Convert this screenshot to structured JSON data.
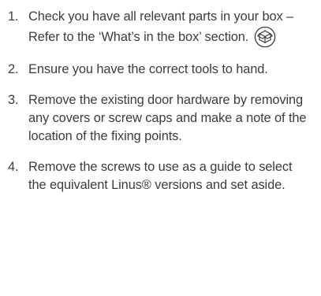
{
  "steps": [
    {
      "number": "1.",
      "text": "Check you have all relevant parts in your box – Refer to the ‘What’s in the box’ section.",
      "icon": "box-parts-icon"
    },
    {
      "number": "2.",
      "text": "Ensure you have the correct tools to hand."
    },
    {
      "number": "3.",
      "text": "Remove the existing door hardware by removing any covers or screw caps and make a note of the location of the fixing points."
    },
    {
      "number": "4.",
      "text": "Remove the screws to use as a guide to select the equivalent Linus® versions and set aside."
    }
  ],
  "colors": {
    "text": "#3a3d40",
    "icon_stroke": "#3a3d40"
  }
}
